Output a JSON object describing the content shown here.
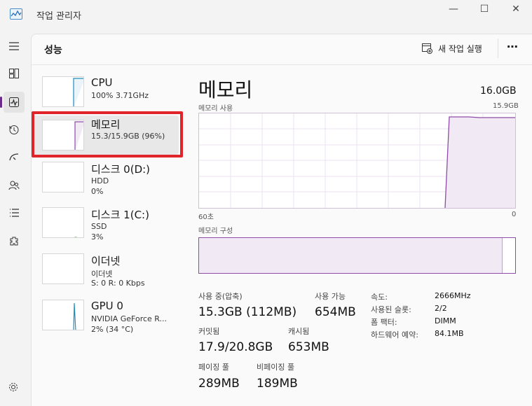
{
  "window": {
    "title": "작업 관리자",
    "minimize": "—",
    "maximize": "☐",
    "close": "✕"
  },
  "nav": {
    "items": [
      "menu-icon",
      "processes-icon",
      "performance-icon",
      "app-history-icon",
      "startup-icon",
      "users-icon",
      "details-icon",
      "services-icon",
      "settings-icon"
    ],
    "active": "performance-icon"
  },
  "header": {
    "title": "성능",
    "run_task": "새 작업 실행",
    "more": "⋯"
  },
  "resources": [
    {
      "title": "CPU",
      "line1": "100% 3.71GHz",
      "line2": ""
    },
    {
      "title": "메모리",
      "line1": "15.3/15.9GB (96%)",
      "line2": ""
    },
    {
      "title": "디스크 0(D:)",
      "line1": "HDD",
      "line2": "0%"
    },
    {
      "title": "디스크 1(C:)",
      "line1": "SSD",
      "line2": "3%"
    },
    {
      "title": "이더넷",
      "line1": "이더넷",
      "line2": "S: 0 R: 0 Kbps"
    },
    {
      "title": "GPU 0",
      "line1": "NVIDIA GeForce R...",
      "line2": "2% (34 °C)"
    }
  ],
  "detail": {
    "title": "메모리",
    "total": "16.0GB",
    "usage_label": "메모리 사용",
    "usage_max": "15.9GB",
    "time_label": "60초",
    "time_zero": "0",
    "composition_label": "메모리 구성",
    "composition_used_fraction": 0.96
  },
  "stats": {
    "in_use_label": "사용 중(압축)",
    "in_use_value": "15.3GB (112MB)",
    "available_label": "사용 가능",
    "available_value": "654MB",
    "committed_label": "커밋됨",
    "committed_value": "17.9/20.8GB",
    "cached_label": "캐시됨",
    "cached_value": "653MB",
    "paged_label": "페이징 풀",
    "paged_value": "289MB",
    "nonpaged_label": "비페이징 풀",
    "nonpaged_value": "189MB"
  },
  "specs": [
    {
      "key": "속도:",
      "value": "2666MHz"
    },
    {
      "key": "사용된 슬롯:",
      "value": "2/2"
    },
    {
      "key": "폼 팩터:",
      "value": "DIMM"
    },
    {
      "key": "하드웨어 예약:",
      "value": "84.1MB"
    }
  ],
  "colors": {
    "accent": "#8e4ca8",
    "accent_fill": "#f1e9f4",
    "cpu_line": "#1f8fc3",
    "highlight": "#e0242a"
  }
}
